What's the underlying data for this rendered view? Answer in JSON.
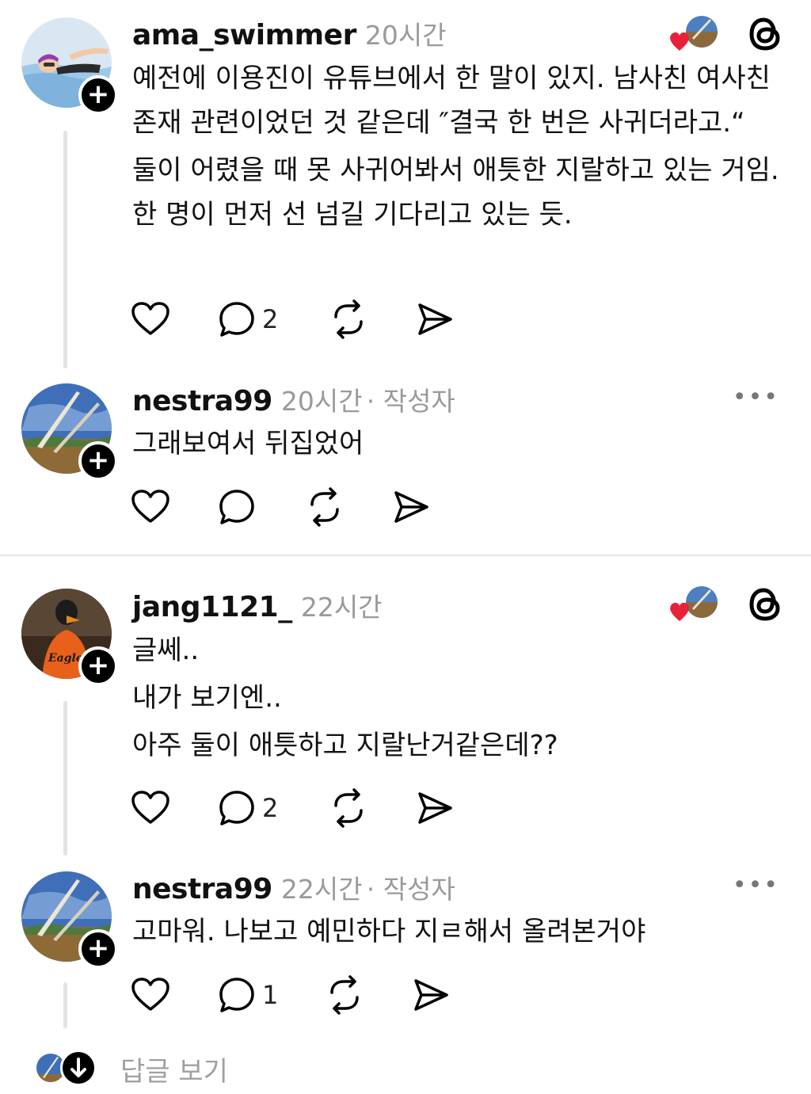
{
  "posts": [
    {
      "username": "ama_swimmer",
      "time": "20시간",
      "author_tag": "",
      "avatar": "swimmer-emoji-avatar",
      "lines": [
        "예전에 이용진이 유튜브에서 한 말이 있지. 남사친 여사친 존재 관련이었던 것 같은데 ″결국 한 번은 사귀더라고.“",
        "둘이 어렸을 때 못 사귀어봐서 애틋한 지랄하고 있는 거임. 한 명이 먼저 선 넘길 기다리고 있는 듯."
      ],
      "reply_count": "2",
      "top_right": "liked-by-author-and-threads-icon"
    },
    {
      "username": "nestra99",
      "time": "20시간",
      "author_tag": "· 작성자",
      "avatar": "landscape-avatar",
      "lines": [
        "그래보여서 뒤집었어"
      ],
      "reply_count": "",
      "top_right": "more-menu"
    },
    {
      "username": "jang1121_",
      "time": "22시간",
      "author_tag": "",
      "avatar": "eagles-mascot-avatar",
      "lines": [
        "글쎄..",
        "내가 보기엔..",
        "아주 둘이 애틋하고 지랄난거같은데??"
      ],
      "reply_count": "2",
      "top_right": "liked-by-author-and-threads-icon"
    },
    {
      "username": "nestra99",
      "time": "22시간",
      "author_tag": "· 작성자",
      "avatar": "landscape-avatar",
      "lines": [
        "고마워. 나보고 예민하다 지ㄹ해서 올려본거야"
      ],
      "reply_count": "1",
      "top_right": "more-menu"
    }
  ],
  "follow_badge": "+",
  "more_menu": "•••",
  "view_replies": {
    "label": "답글 보기"
  },
  "colors": {
    "like_heart": "#e8213b",
    "secondary_text": "#9a9a9a",
    "divider": "#e6e6e6"
  }
}
